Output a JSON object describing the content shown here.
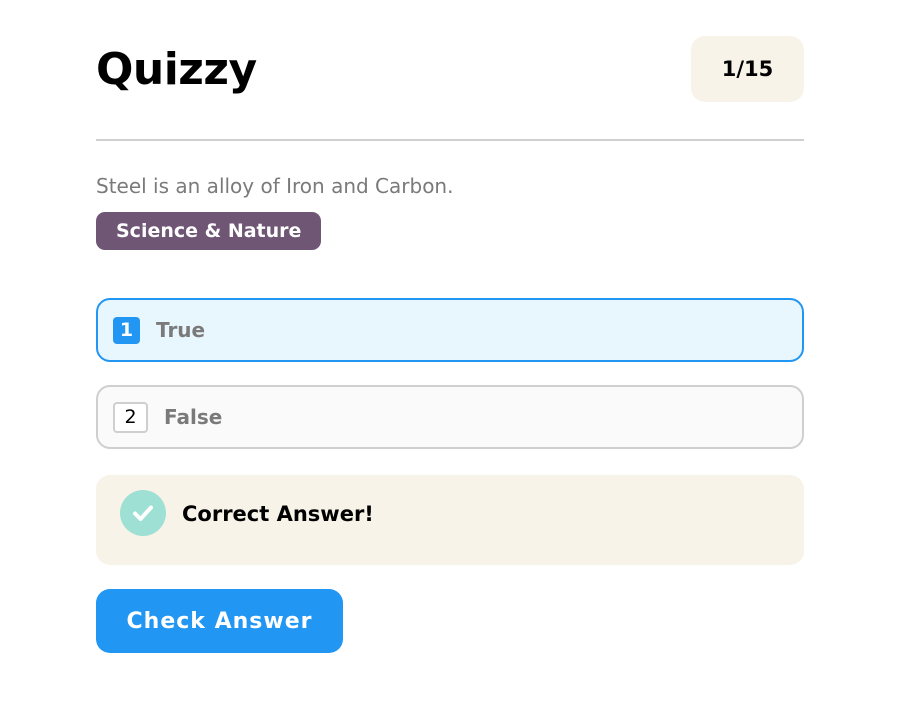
{
  "header": {
    "app_title": "Quizzy",
    "progress": "1/15"
  },
  "question": {
    "text": "Steel is an alloy of Iron and Carbon.",
    "category": "Science & Nature"
  },
  "options": [
    {
      "number": "1",
      "label": "True",
      "selected": true
    },
    {
      "number": "2",
      "label": "False",
      "selected": false
    }
  ],
  "feedback": {
    "icon": "check-icon",
    "message": "Correct Answer!"
  },
  "actions": {
    "check_label": "Check Answer"
  },
  "colors": {
    "accent": "#2196f3",
    "category_bg": "#6e5674",
    "panel_bg": "#f7f3e8",
    "success": "#9ee0d4"
  }
}
